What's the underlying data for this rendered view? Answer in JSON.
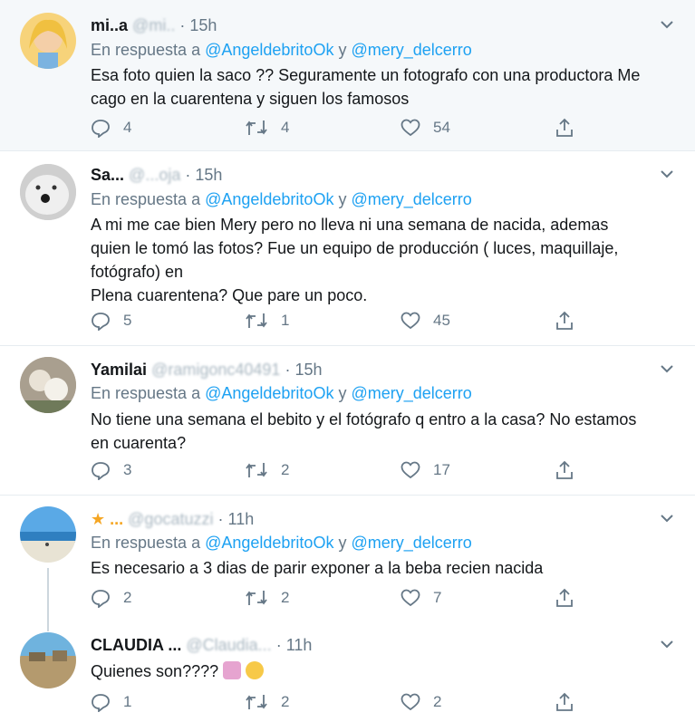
{
  "tweets": [
    {
      "name": "mi..a",
      "handle_blurred": "@mi..",
      "time": "15h",
      "reply_prefix": "En respuesta a",
      "mention1": "@AngeldebritoOk",
      "reply_and": "y",
      "mention2": "@mery_delcerro",
      "lines": [
        "Esa foto quien la saco ?? Seguramente un fotografo con una productora Me",
        "cago en la cuarentena y siguen los famosos"
      ],
      "replies": "4",
      "retweets": "4",
      "likes": "54"
    },
    {
      "name": "Sa...",
      "handle_blurred": "@...oja",
      "time": "15h",
      "reply_prefix": "En respuesta a",
      "mention1": "@AngeldebritoOk",
      "reply_and": "y",
      "mention2": "@mery_delcerro",
      "lines": [
        "A mi me cae bien Mery pero no lleva ni una semana de nacida, ademas",
        "quien le tomó las fotos? Fue un equipo de producción ( luces, maquillaje,",
        "fotógrafo) en",
        "Plena cuarentena? Que pare un poco."
      ],
      "replies": "5",
      "retweets": "1",
      "likes": "45"
    },
    {
      "name": "Yamilai",
      "handle_blurred": "@ramigonc40491",
      "time": "15h",
      "reply_prefix": "En respuesta a",
      "mention1": "@AngeldebritoOk",
      "reply_and": "y",
      "mention2": "@mery_delcerro",
      "lines": [
        "No tiene una semana el bebito y el fotógrafo q entro a la casa? No estamos",
        "en cuarenta?"
      ],
      "replies": "3",
      "retweets": "2",
      "likes": "17"
    },
    {
      "name": "★ ...",
      "handle_blurred": "@gocatuzzi",
      "time": "11h",
      "reply_prefix": "En respuesta a",
      "mention1": "@AngeldebritoOk",
      "reply_and": "y",
      "mention2": "@mery_delcerro",
      "lines": [
        "Es necesario a 3 dias de parir exponer a la beba recien nacida"
      ],
      "replies": "2",
      "retweets": "2",
      "likes": "7"
    },
    {
      "name": "CLAUDIA ...",
      "handle_blurred": "@Claudia...",
      "time": "11h",
      "lines": [
        "Quienes son????"
      ],
      "replies": "1",
      "retweets": "2",
      "likes": "2"
    }
  ],
  "time_sep": "·",
  "colors": {
    "accent": "#1da1f2",
    "muted": "#657786",
    "highlight_bg": "#f5f8fa",
    "border": "#e6ecf0"
  },
  "icons": [
    "chevron-down-icon",
    "reply-icon",
    "retweet-icon",
    "like-icon",
    "share-icon"
  ]
}
